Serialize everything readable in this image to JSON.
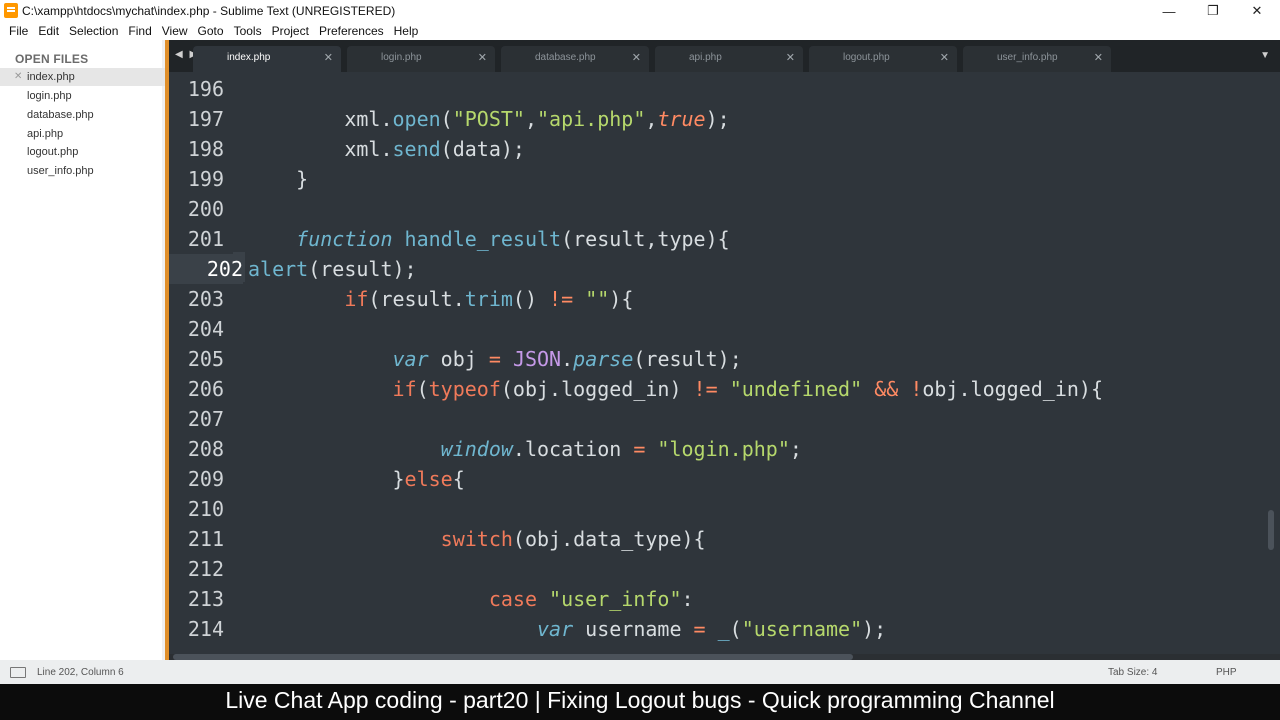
{
  "window": {
    "title": "C:\\xampp\\htdocs\\mychat\\index.php - Sublime Text (UNREGISTERED)",
    "controls": {
      "minimize": "—",
      "restore": "❐",
      "close": "✕"
    }
  },
  "menu": [
    "File",
    "Edit",
    "Selection",
    "Find",
    "View",
    "Goto",
    "Tools",
    "Project",
    "Preferences",
    "Help"
  ],
  "sidebar": {
    "heading": "OPEN FILES",
    "files": [
      {
        "name": "index.php",
        "active": true
      },
      {
        "name": "login.php"
      },
      {
        "name": "database.php"
      },
      {
        "name": "api.php"
      },
      {
        "name": "logout.php"
      },
      {
        "name": "user_info.php"
      }
    ],
    "close_glyph": "✕"
  },
  "tabs": {
    "nav_arrows": "◀ ▶",
    "close_glyph": "✕",
    "menu_glyph": "▼",
    "items": [
      {
        "label": "index.php",
        "active": true
      },
      {
        "label": "login.php"
      },
      {
        "label": "database.php"
      },
      {
        "label": "api.php"
      },
      {
        "label": "logout.php"
      },
      {
        "label": "user_info.php"
      }
    ]
  },
  "editor": {
    "current_line": "202",
    "lines": [
      {
        "no": "196",
        "tokens": []
      },
      {
        "no": "197",
        "tokens": [
          [
            "",
            "        xml."
          ],
          [
            "fn",
            "open"
          ],
          [
            "",
            "("
          ],
          [
            "str",
            "\"POST\""
          ],
          [
            "",
            ","
          ],
          [
            "str",
            "\"api.php\""
          ],
          [
            "",
            ","
          ],
          [
            "bool",
            "true"
          ],
          [
            "",
            ");"
          ]
        ]
      },
      {
        "no": "198",
        "tokens": [
          [
            "",
            "        xml."
          ],
          [
            "fn",
            "send"
          ],
          [
            "",
            "(data);"
          ]
        ]
      },
      {
        "no": "199",
        "tokens": [
          [
            "",
            "    }"
          ]
        ]
      },
      {
        "no": "200",
        "tokens": []
      },
      {
        "no": "201",
        "tokens": [
          [
            "",
            "    "
          ],
          [
            "ital",
            "function"
          ],
          [
            "",
            " "
          ],
          [
            "fn",
            "handle_result"
          ],
          [
            "",
            "(result,type){"
          ]
        ]
      },
      {
        "no": "202",
        "tokens": [
          [
            "fn",
            "alert"
          ],
          [
            "",
            "(result);"
          ]
        ]
      },
      {
        "no": "203",
        "tokens": [
          [
            "",
            "        "
          ],
          [
            "kw",
            "if"
          ],
          [
            "",
            "(result."
          ],
          [
            "fn",
            "trim"
          ],
          [
            "",
            "() "
          ],
          [
            "op",
            "!="
          ],
          [
            "",
            " "
          ],
          [
            "str",
            "\"\""
          ],
          [
            "",
            "){"
          ]
        ]
      },
      {
        "no": "204",
        "tokens": []
      },
      {
        "no": "205",
        "tokens": [
          [
            "",
            "            "
          ],
          [
            "ital",
            "var"
          ],
          [
            "",
            " obj "
          ],
          [
            "op",
            "="
          ],
          [
            "",
            " "
          ],
          [
            "purple",
            "JSON"
          ],
          [
            "",
            "."
          ],
          [
            "ital",
            "parse"
          ],
          [
            "",
            "(result);"
          ]
        ]
      },
      {
        "no": "206",
        "tokens": [
          [
            "",
            "            "
          ],
          [
            "kw",
            "if"
          ],
          [
            "",
            "("
          ],
          [
            "kw",
            "typeof"
          ],
          [
            "",
            "(obj.logged_in) "
          ],
          [
            "op",
            "!="
          ],
          [
            "",
            " "
          ],
          [
            "str",
            "\"undefined\""
          ],
          [
            "",
            " "
          ],
          [
            "op",
            "&&"
          ],
          [
            "",
            " "
          ],
          [
            "op",
            "!"
          ],
          [
            "",
            "obj.logged_in){"
          ]
        ]
      },
      {
        "no": "207",
        "tokens": []
      },
      {
        "no": "208",
        "tokens": [
          [
            "",
            "                "
          ],
          [
            "ital",
            "window"
          ],
          [
            "",
            ".location "
          ],
          [
            "op",
            "="
          ],
          [
            "",
            " "
          ],
          [
            "str",
            "\"login.php\""
          ],
          [
            "",
            ";"
          ]
        ]
      },
      {
        "no": "209",
        "tokens": [
          [
            "",
            "            }"
          ],
          [
            "kw",
            "else"
          ],
          [
            "",
            "{"
          ]
        ]
      },
      {
        "no": "210",
        "tokens": []
      },
      {
        "no": "211",
        "tokens": [
          [
            "",
            "                "
          ],
          [
            "kw",
            "switch"
          ],
          [
            "",
            "(obj.data_type){"
          ]
        ]
      },
      {
        "no": "212",
        "tokens": []
      },
      {
        "no": "213",
        "tokens": [
          [
            "",
            "                    "
          ],
          [
            "kw",
            "case"
          ],
          [
            "",
            " "
          ],
          [
            "str",
            "\"user_info\""
          ],
          [
            "",
            ":"
          ]
        ]
      },
      {
        "no": "214",
        "tokens": [
          [
            "",
            "                        "
          ],
          [
            "ital",
            "var"
          ],
          [
            "",
            " username "
          ],
          [
            "op",
            "="
          ],
          [
            "",
            " "
          ],
          [
            "fn",
            "_"
          ],
          [
            "",
            "("
          ],
          [
            "str",
            "\"username\""
          ],
          [
            "",
            ");"
          ]
        ]
      }
    ]
  },
  "status": {
    "position": "Line 202, Column 6",
    "tab_size": "Tab Size: 4",
    "syntax": "PHP"
  },
  "caption": "Live Chat App coding - part20 | Fixing Logout bugs - Quick programming Channel"
}
